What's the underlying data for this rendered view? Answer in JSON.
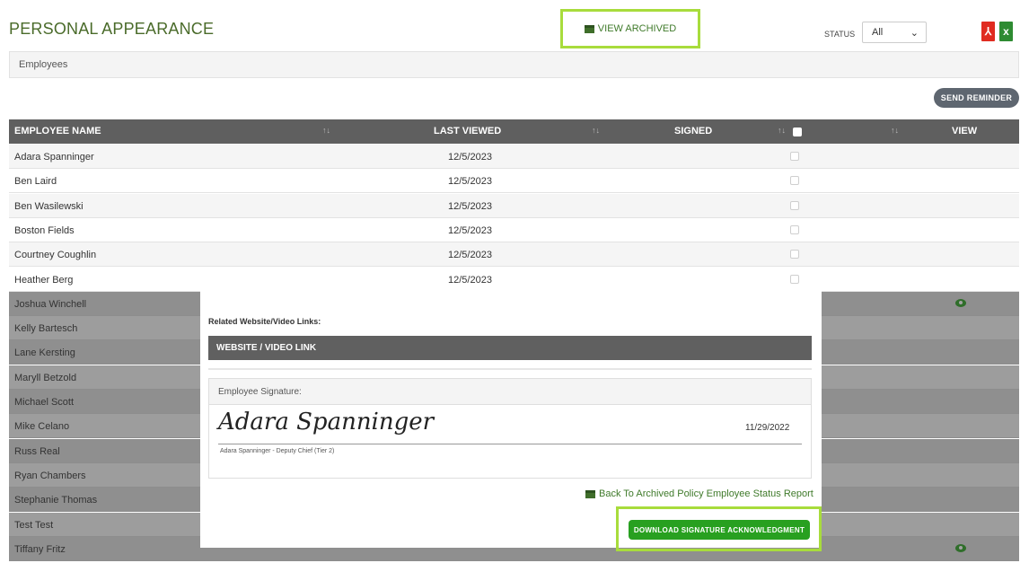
{
  "page": {
    "title": "PERSONAL APPEARANCE",
    "view_archived": "VIEW ARCHIVED",
    "status_label": "STATUS",
    "status_value": "All",
    "pdf_icon_glyph": "⅄",
    "excel_icon_glyph": "x",
    "filter_text": "Employees",
    "send_reminder": "SEND REMINDER"
  },
  "table": {
    "headers": {
      "name": "EMPLOYEE NAME",
      "last_viewed": "LAST VIEWED",
      "signed": "SIGNED",
      "view": "VIEW",
      "sort_glyph": "↑↓"
    },
    "rows": [
      {
        "name": "Adara Spanninger",
        "date": "12/5/2023"
      },
      {
        "name": "Ben Laird",
        "date": "12/5/2023"
      },
      {
        "name": "Ben Wasilewski",
        "date": "12/5/2023"
      },
      {
        "name": "Boston Fields",
        "date": "12/5/2023"
      },
      {
        "name": "Courtney Coughlin",
        "date": "12/5/2023"
      },
      {
        "name": "Heather Berg",
        "date": "12/5/2023"
      },
      {
        "name": "Joshua Winchell",
        "date": ""
      },
      {
        "name": "Kelly Bartesch",
        "date": ""
      },
      {
        "name": "Lane Kersting",
        "date": ""
      },
      {
        "name": "Maryll Betzold",
        "date": ""
      },
      {
        "name": "Michael Scott",
        "date": ""
      },
      {
        "name": "Mike Celano",
        "date": ""
      },
      {
        "name": "Russ Real",
        "date": ""
      },
      {
        "name": "Ryan Chambers",
        "date": ""
      },
      {
        "name": "Stephanie Thomas",
        "date": ""
      },
      {
        "name": "Test Test",
        "date": ""
      },
      {
        "name": "Tiffany Fritz",
        "date": ""
      }
    ]
  },
  "modal": {
    "related_label": "Related Website/Video Links:",
    "website_header": "WEBSITE / VIDEO LINK",
    "signature_label": "Employee Signature:",
    "signature_script": "Adara Spanninger",
    "signature_date": "11/29/2022",
    "signer_caption": "Adara Spanninger - Deputy Chief (Tier 2)",
    "back_link": "Back To Archived Policy Employee Status Report",
    "download_button": "DOWNLOAD SIGNATURE ACKNOWLEDGMENT"
  },
  "colors": {
    "accent_green": "#28a020",
    "highlight_outline": "#a8dc3c",
    "header_gray": "#5f5f5f"
  }
}
